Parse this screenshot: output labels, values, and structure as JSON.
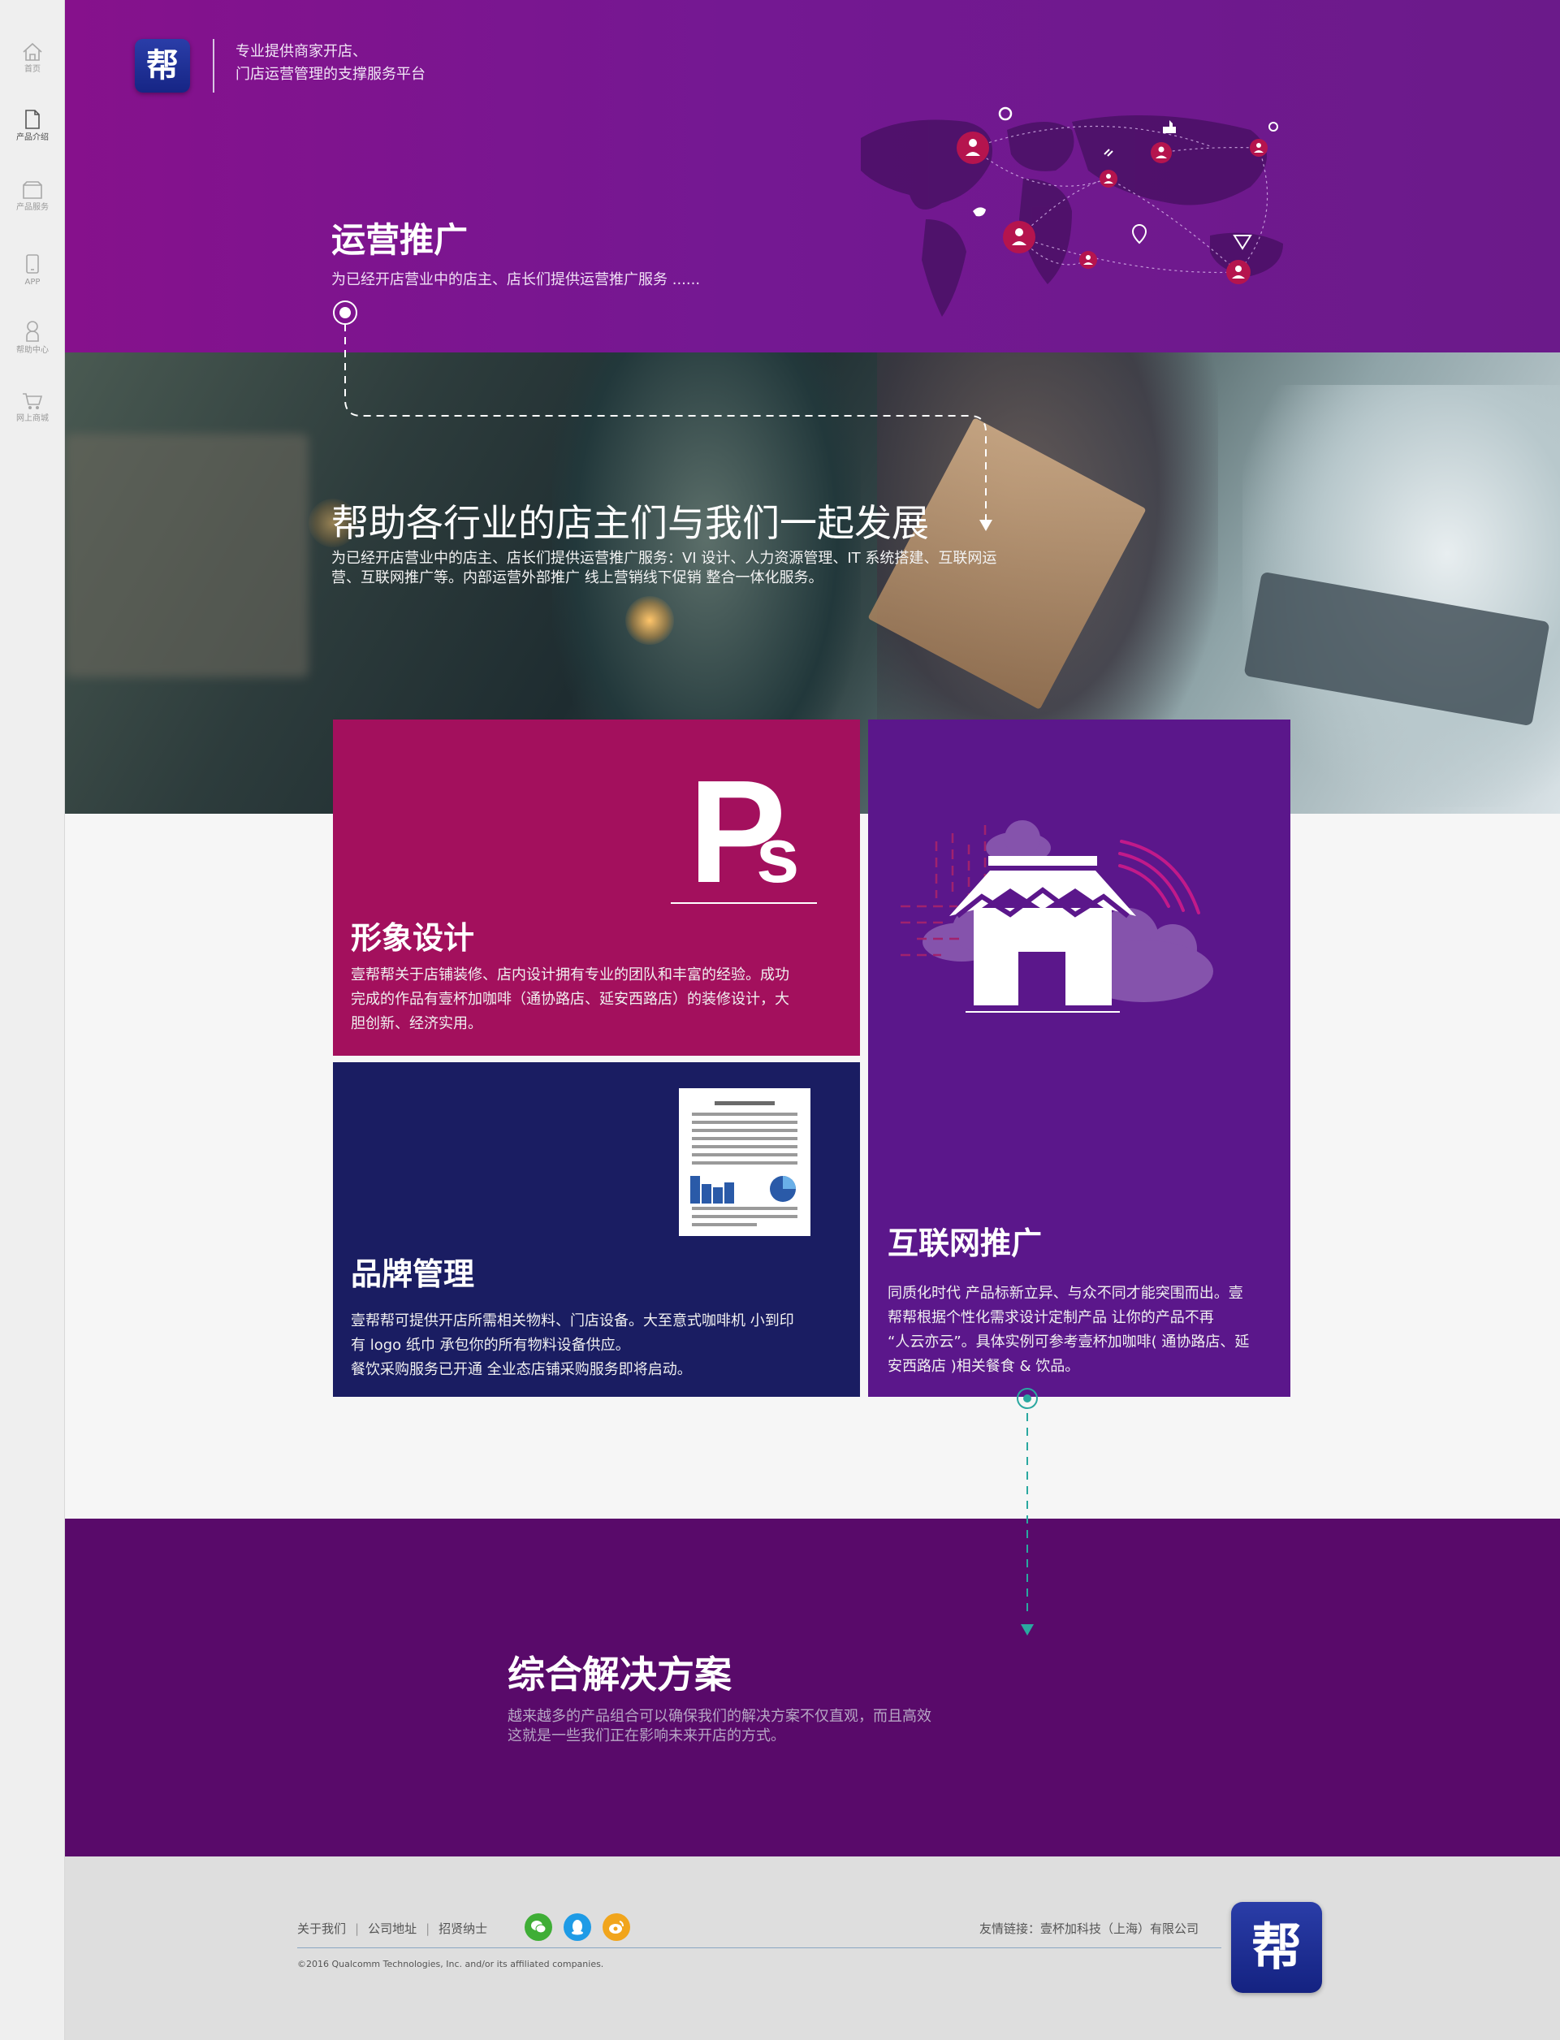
{
  "brand": {
    "logo_char": "帮",
    "tagline_line1": "专业提供商家开店、",
    "tagline_line2": "门店运营管理的支撑服务平台"
  },
  "sidebar": {
    "items": [
      {
        "label": "首页",
        "icon": "home-icon"
      },
      {
        "label": "产品介绍",
        "icon": "document-icon",
        "active": true
      },
      {
        "label": "产品服务",
        "icon": "box-icon"
      },
      {
        "label": "APP",
        "icon": "phone-icon"
      },
      {
        "label": "帮助中心",
        "icon": "person-icon"
      },
      {
        "label": "网上商城",
        "icon": "cart-icon"
      }
    ]
  },
  "hero": {
    "title": "运营推广",
    "subtitle": "为已经开店营业中的店主、店长们提供运营推广服务 ......"
  },
  "banner": {
    "title": "帮助各行业的店主们与我们一起发展",
    "text_line1": "为已经开店营业中的店主、店长们提供运营推广服务：VI 设计、人力资源管理、IT 系统搭建、互联网运",
    "text_line2": "营、互联网推广等。内部运营外部推广 线上营销线下促销 整合一体化服务。"
  },
  "cards": {
    "design": {
      "title": "形象设计",
      "line1": "壹帮帮关于店铺装修、店内设计拥有专业的团队和丰富的经验。成功",
      "line2": "完成的作品有壹杯加咖啡（通协路店、延安西路店）的装修设计，大",
      "line3": "胆创新、经济实用。",
      "icon_text": "Ps"
    },
    "brand": {
      "title": "品牌管理",
      "line1": "壹帮帮可提供开店所需相关物料、门店设备。大至意式咖啡机 小到印",
      "line2": "有 logo 纸巾 承包你的所有物料设备供应。",
      "line3": "餐饮采购服务已开通 全业态店铺采购服务即将启动。"
    },
    "internet": {
      "title": "互联网推广",
      "line1": "同质化时代 产品标新立异、与众不同才能突围而出。壹",
      "line2": "帮帮根据个性化需求设计定制产品 让你的产品不再",
      "line3": "“人云亦云”。具体实例可参考壹杯加咖啡( 通协路店、延",
      "line4": "安西路店 )相关餐食 & 饮品。"
    }
  },
  "solutions": {
    "title": "综合解决方案",
    "line1": "越来越多的产品组合可以确保我们的解决方案不仅直观，而且高效",
    "line2": "这就是一些我们正在影响未来开店的方式。"
  },
  "footer": {
    "links": [
      "关于我们",
      "公司地址",
      "招贤纳士"
    ],
    "social": [
      {
        "icon": "wechat-icon",
        "color": "#3fae36"
      },
      {
        "icon": "qq-icon",
        "color": "#1e9be6"
      },
      {
        "icon": "weibo-icon",
        "color": "#f1a51c"
      }
    ],
    "friend_link": "友情链接：壹杯加科技（上海）有限公司",
    "copyright": "©2016 Qualcomm Technologies, Inc. and/or its affiliated companies.",
    "logo_char": "帮"
  },
  "colors": {
    "hero": "#7a168e",
    "card_design": "#a3105d",
    "card_brand": "#1a1d62",
    "card_internet": "#5b178b",
    "solutions": "#590a6a",
    "accent_teal": "#2aa8a0"
  }
}
